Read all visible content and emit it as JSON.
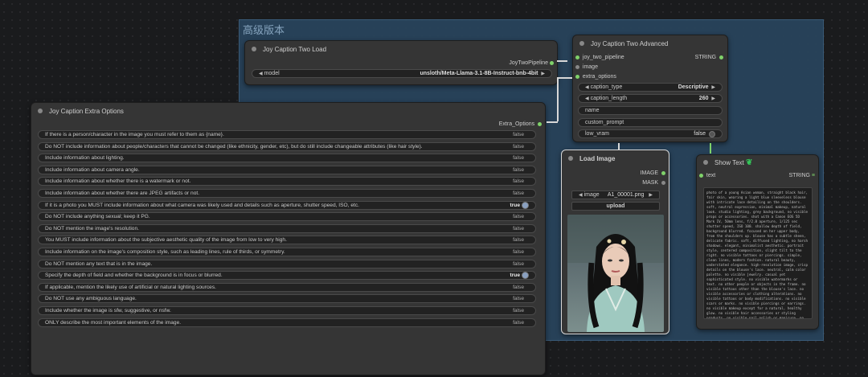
{
  "group": {
    "title": "高级版本"
  },
  "load_node": {
    "title": "Joy Caption Two Load",
    "output": "JoyTwoPipeline",
    "model_label": "model",
    "model_value": "unsloth/Meta-Llama-3.1-8B-Instruct-bnb-4bit"
  },
  "advanced_node": {
    "title": "Joy Caption Two Advanced",
    "inputs": [
      "joy_two_pipeline",
      "image",
      "extra_options"
    ],
    "output": "STRING",
    "caption_type_label": "caption_type",
    "caption_type_value": "Descriptive",
    "caption_length_label": "caption_length",
    "caption_length_value": "260",
    "name_label": "name",
    "custom_prompt_label": "custom_prompt",
    "low_vram_label": "low_vram",
    "low_vram_value": "false"
  },
  "extra_node": {
    "title": "Joy Caption Extra Options",
    "output": "Extra_Options",
    "options": [
      {
        "label": "If there is a person/character in the image you must refer to them as {name}.",
        "value": "false"
      },
      {
        "label": "Do NOT include information about people/characters that cannot be changed (like ethnicity, gender, etc), but do still include changeable attributes (like hair style).",
        "value": "false"
      },
      {
        "label": "Include information about lighting.",
        "value": "false"
      },
      {
        "label": "Include information about camera angle.",
        "value": "false"
      },
      {
        "label": "Include information about whether there is a watermark or not.",
        "value": "false"
      },
      {
        "label": "Include information about whether there are JPEG artifacts or not.",
        "value": "false"
      },
      {
        "label": "If it is a photo you MUST include information about what camera was likely used and details such as aperture, shutter speed, ISO, etc.",
        "value": "true"
      },
      {
        "label": "Do NOT include anything sexual; keep it PG.",
        "value": "false"
      },
      {
        "label": "Do NOT mention the image's resolution.",
        "value": "false"
      },
      {
        "label": "You MUST include information about the subjective aesthetic quality of the image from low to very high.",
        "value": "false"
      },
      {
        "label": "Include information on the image's composition style, such as leading lines, rule of thirds, or symmetry.",
        "value": "false"
      },
      {
        "label": "Do NOT mention any text that is in the image.",
        "value": "false"
      },
      {
        "label": "Specify the depth of field and whether the background is in focus or blurred.",
        "value": "true"
      },
      {
        "label": "If applicable, mention the likely use of artificial or natural lighting sources.",
        "value": "false"
      },
      {
        "label": "Do NOT use any ambiguous language.",
        "value": "false"
      },
      {
        "label": "Include whether the image is sfw, suggestive, or nsfw.",
        "value": "false"
      },
      {
        "label": "ONLY describe the most important elements of the image.",
        "value": "false"
      }
    ]
  },
  "load_image_node": {
    "title": "Load Image",
    "outputs": [
      "IMAGE",
      "MASK"
    ],
    "image_label": "image",
    "image_value": "A1_00001.png",
    "upload_label": "upload"
  },
  "show_text_node": {
    "title": "Show Text",
    "input": "text",
    "output": "STRING",
    "text": "photo of a young Asian woman, straight black hair, fair skin, wearing a light blue sleeveless blouse with intricate lace detailing on the shoulders. soft, neutral expression, minimal makeup, natural look. studio lighting, grey background, no visible props or accessories. shot with a Canon EOS 5D Mark IV, 50mm lens, f/2.8 aperture, 1/125 sec shutter speed, ISO 100. shallow depth of field, background blurred. focused on her upper body, from the shoulders up. blouse has a subtle sheen, delicate fabric. soft, diffused lighting, no harsh shadows. elegant, minimalist aesthetic. portrait style, centered composition, slight tilt to the right. no visible tattoos or piercings. simple, clean lines, modern fashion. natural beauty, understated elegance. high-resolution image, crisp details on the blouse's lace. neutral, calm color palette. no visible jewelry. casual yet sophisticated style. no visible watermarks or text. no other people or objects in the frame. no visible tattoos other than the blouse's lace. no visible accessories or clothing alterations. no visible tattoos or body modifications. no visible scars or marks. no visible piercings or earrings. no visible makeup except for a natural, healthy glow. no visible hair accessories or styling products. no visible nail polish or manicure. no visible footwear."
  }
}
